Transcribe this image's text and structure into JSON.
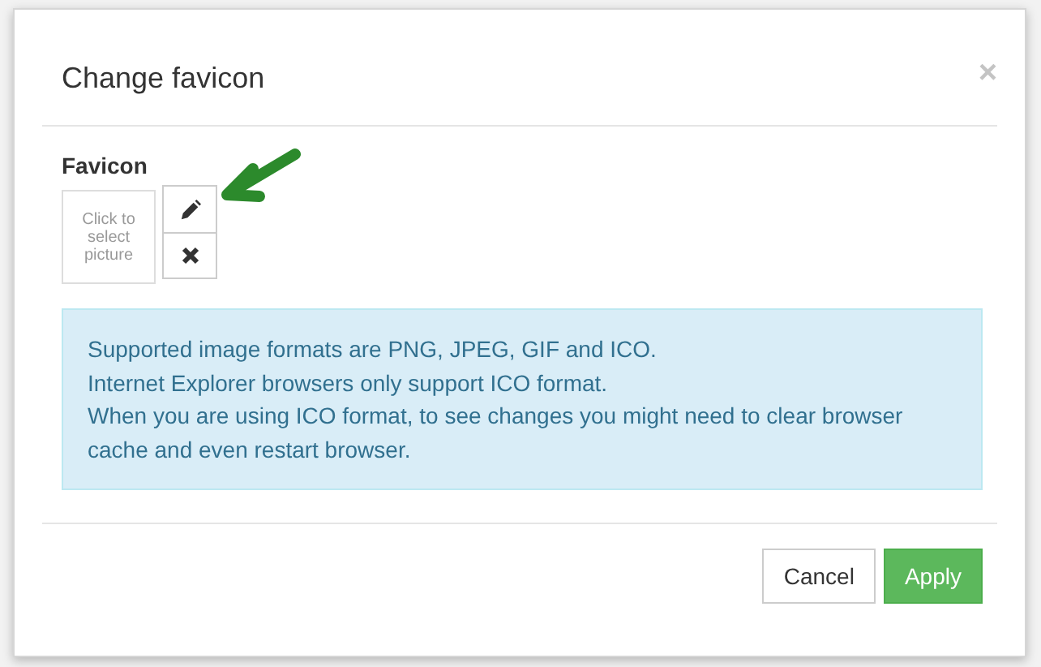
{
  "dialog": {
    "title": "Change favicon",
    "close": "×"
  },
  "field": {
    "label": "Favicon",
    "picture_placeholder": "Click to select picture"
  },
  "info": [
    "Supported image formats are PNG, JPEG, GIF and ICO.",
    "Internet Explorer browsers only support ICO format.",
    "When you are using ICO format, to see changes you might need to clear browser cache and even restart browser."
  ],
  "buttons": [
    {
      "label": "Cancel",
      "kind": "default"
    },
    {
      "label": "Apply",
      "kind": "primary"
    }
  ]
}
